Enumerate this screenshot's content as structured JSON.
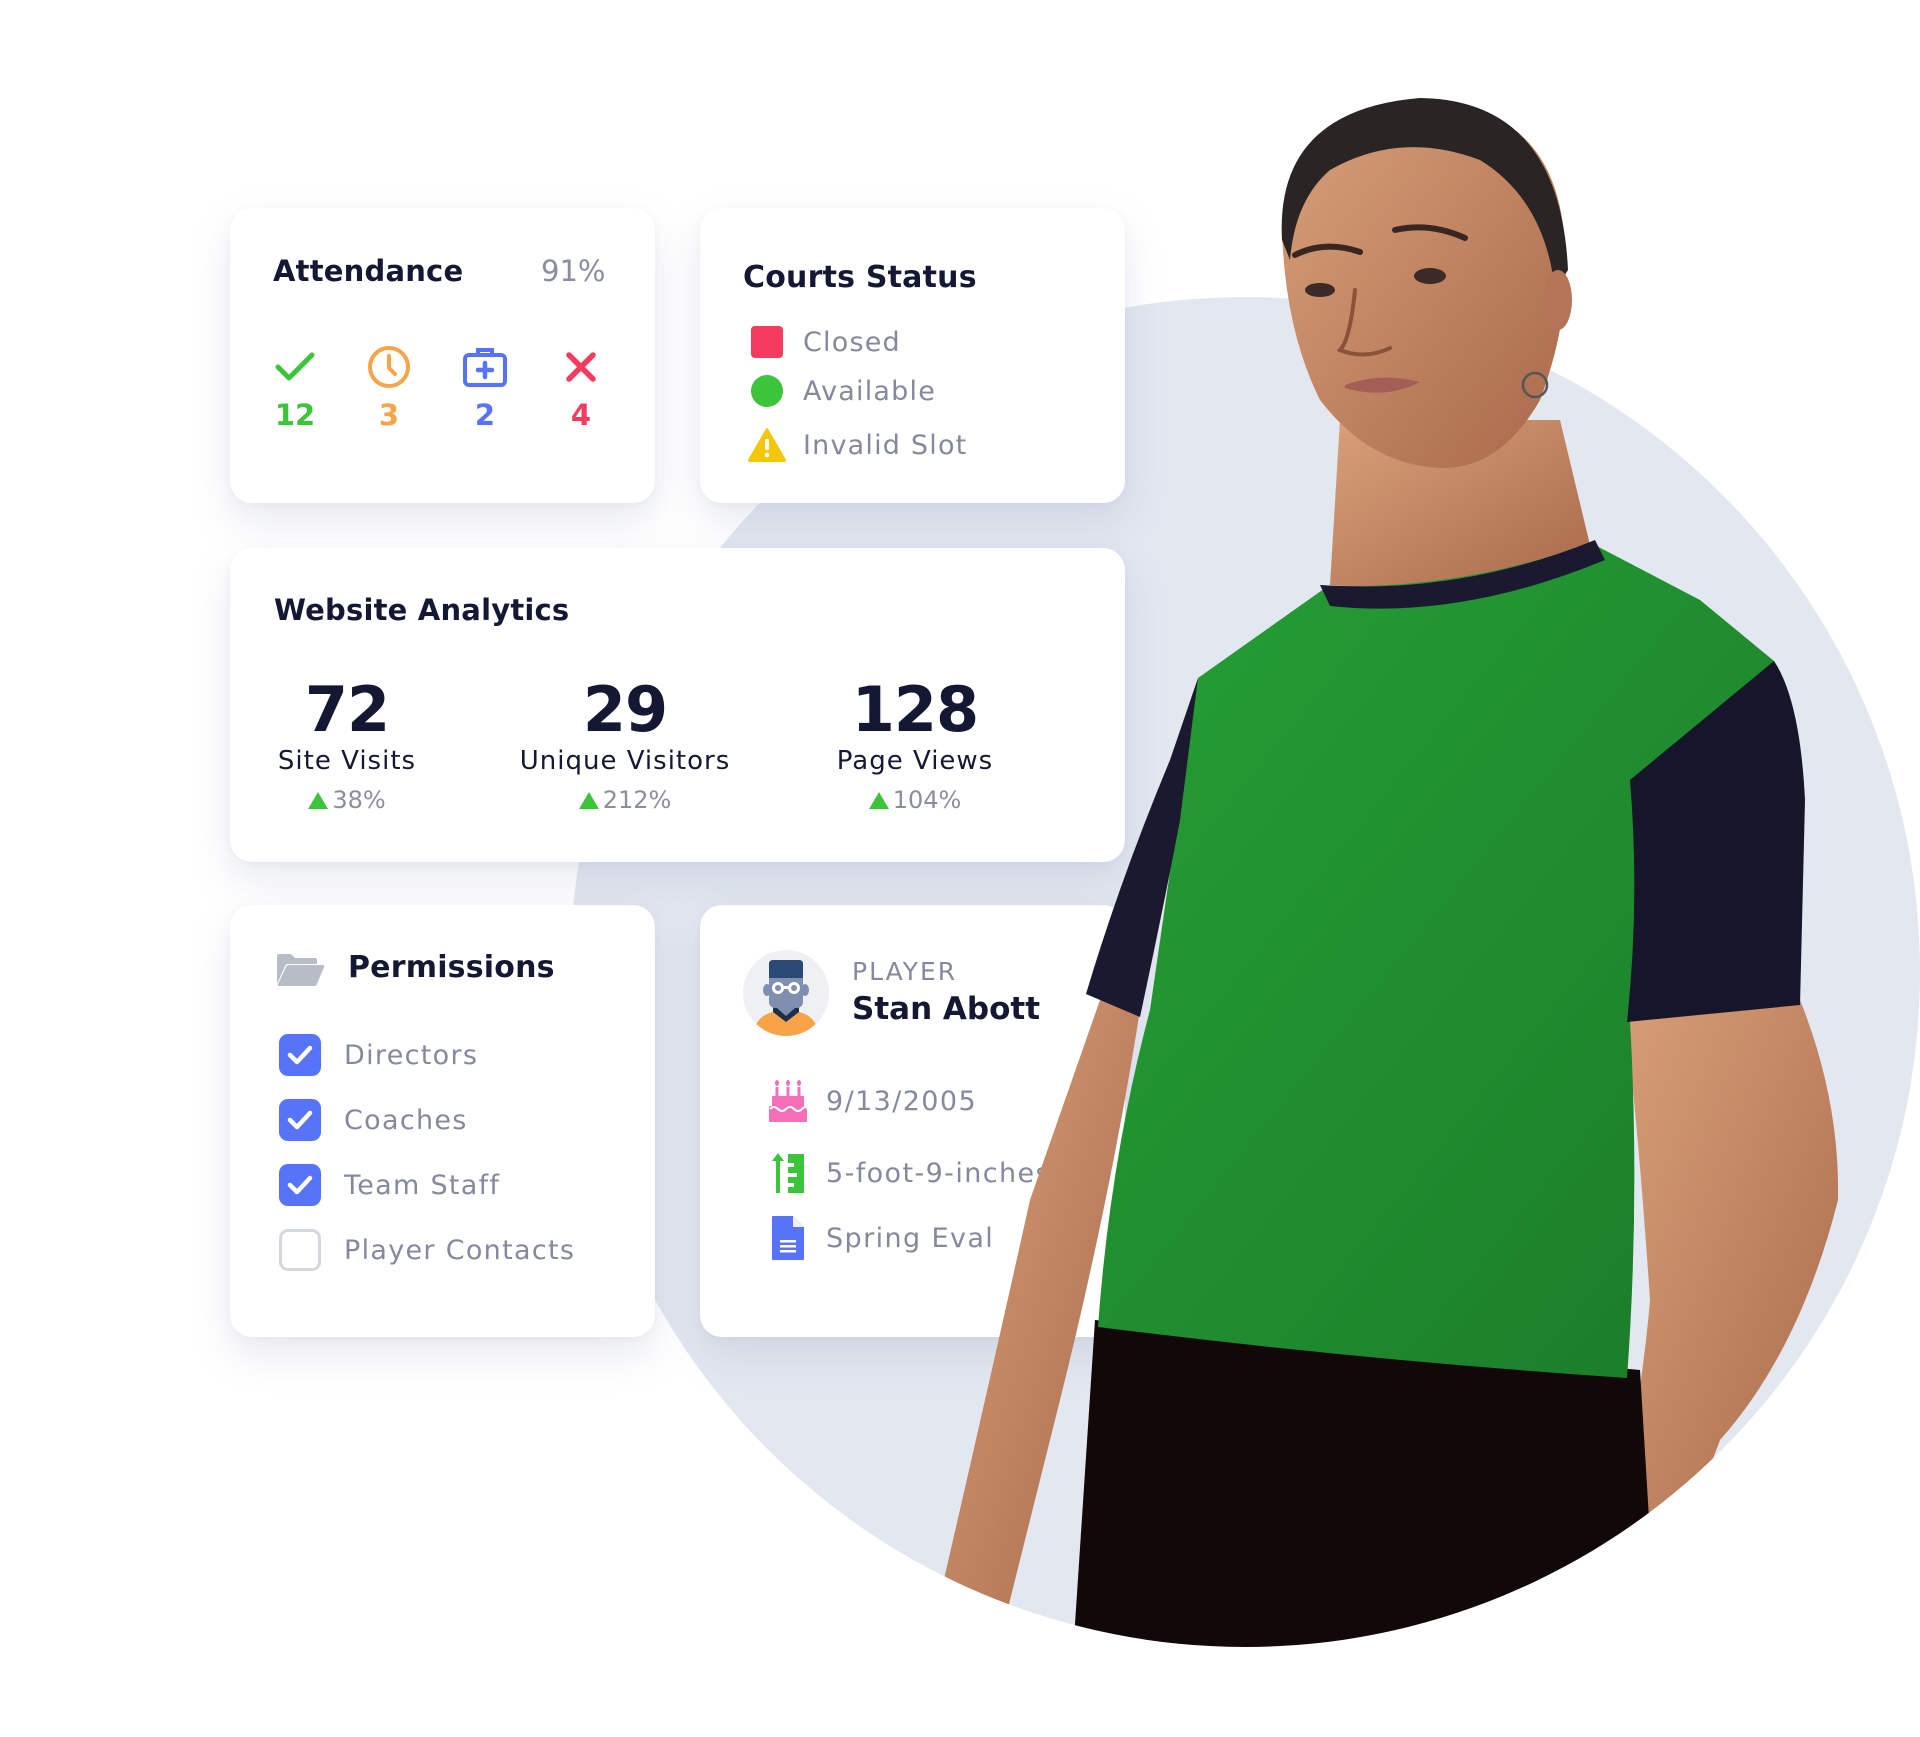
{
  "colors": {
    "heading": "#141833",
    "muted": "#848A9B",
    "background_circle": "#E2E7F0",
    "present": "#3CC43A",
    "late": "#F7A347",
    "excused": "#5774F8",
    "absent": "#F53B5E",
    "warning": "#F5C60A",
    "checkbox_on": "#5774F8",
    "trend_up": "#3CC43A"
  },
  "attendance": {
    "title": "Attendance",
    "rate": "91%",
    "stats": [
      {
        "icon": "check-icon",
        "value": "12",
        "color": "#3CC43A"
      },
      {
        "icon": "clock-icon",
        "value": "3",
        "color": "#F7A347"
      },
      {
        "icon": "medical-kit-icon",
        "value": "2",
        "color": "#5774F8"
      },
      {
        "icon": "x-icon",
        "value": "4",
        "color": "#F53B5E"
      }
    ]
  },
  "courts": {
    "title": "Courts Status",
    "items": [
      {
        "icon": "red-square-icon",
        "label": "Closed"
      },
      {
        "icon": "green-circle-icon",
        "label": "Available"
      },
      {
        "icon": "warning-triangle-icon",
        "label": "Invalid Slot"
      }
    ]
  },
  "analytics": {
    "title": "Website Analytics",
    "stats": [
      {
        "value": "72",
        "label": "Site Visits",
        "change": "38%",
        "direction": "up"
      },
      {
        "value": "29",
        "label": "Unique Visitors",
        "change": "212%",
        "direction": "up"
      },
      {
        "value": "128",
        "label": "Page Views",
        "change": "104%",
        "direction": "up"
      }
    ]
  },
  "permissions": {
    "title": "Permissions",
    "icon": "folder-open-icon",
    "items": [
      {
        "label": "Directors",
        "checked": true
      },
      {
        "label": "Coaches",
        "checked": true
      },
      {
        "label": "Team Staff",
        "checked": true
      },
      {
        "label": "Player Contacts",
        "checked": false
      }
    ]
  },
  "player": {
    "role": "PLAYER",
    "name": "Stan Abott",
    "avatar": "player-avatar-icon",
    "details": [
      {
        "icon": "birthday-cake-icon",
        "label": "9/13/2005"
      },
      {
        "icon": "height-ruler-icon",
        "label": "5-foot-9-inches"
      },
      {
        "icon": "document-icon",
        "label": "Spring Eval"
      }
    ]
  },
  "hero": {
    "subject": "athlete in green and black jersey"
  }
}
